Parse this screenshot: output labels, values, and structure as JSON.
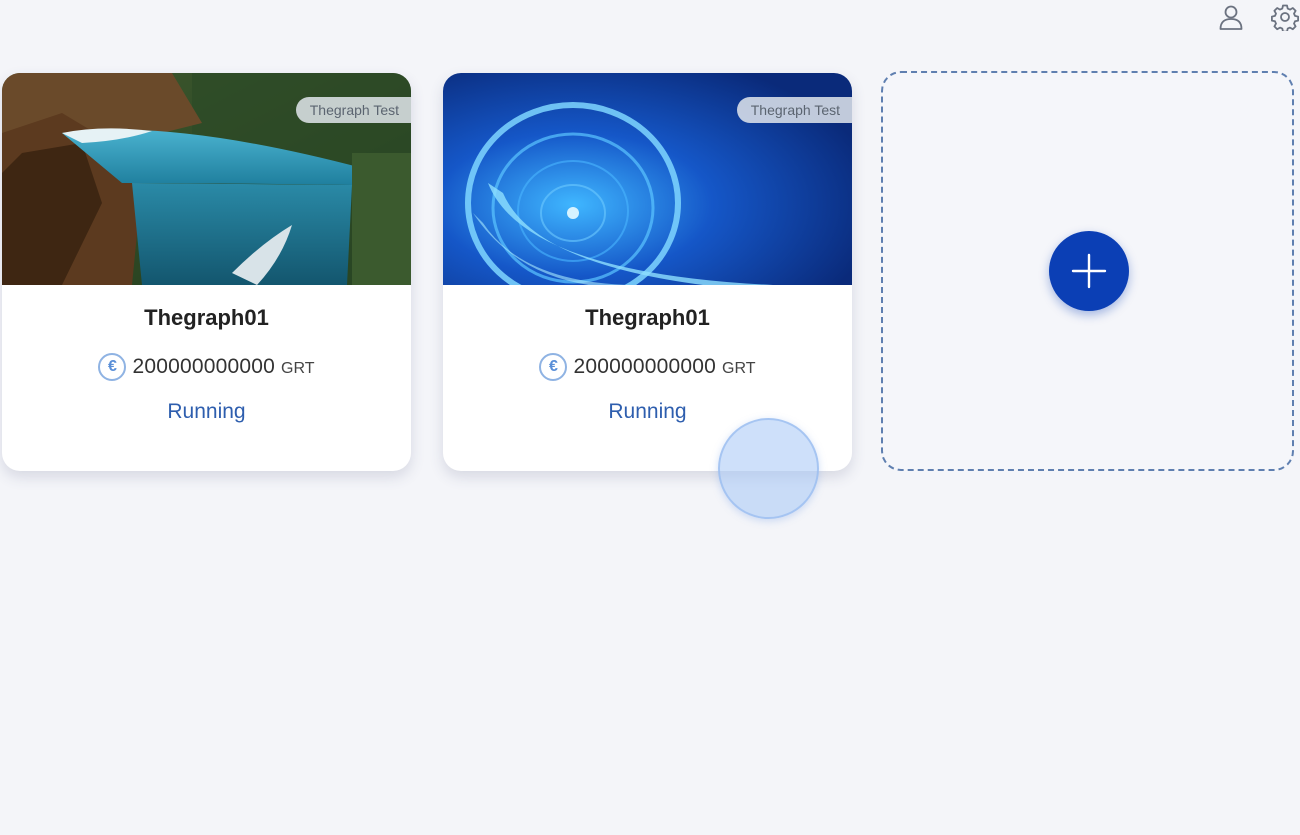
{
  "header": {
    "icons": [
      "user-icon",
      "gear-icon"
    ]
  },
  "cards": [
    {
      "tag": "Thegraph Test",
      "name": "Thegraph01",
      "amount": "200000000000",
      "unit": "GRT",
      "status": "Running",
      "coin_symbol": "€",
      "image": "cliff-waterfall-lake"
    },
    {
      "tag": "Thegraph Test",
      "name": "Thegraph01",
      "amount": "200000000000",
      "unit": "GRT",
      "status": "Running",
      "coin_symbol": "€",
      "image": "blue-digital-tunnel"
    }
  ],
  "add_card": {
    "icon": "plus-icon"
  },
  "colors": {
    "accent": "#0b3fb5",
    "status": "#2e5eae",
    "coin": "#5a8fd8",
    "background": "#f4f5f9"
  }
}
